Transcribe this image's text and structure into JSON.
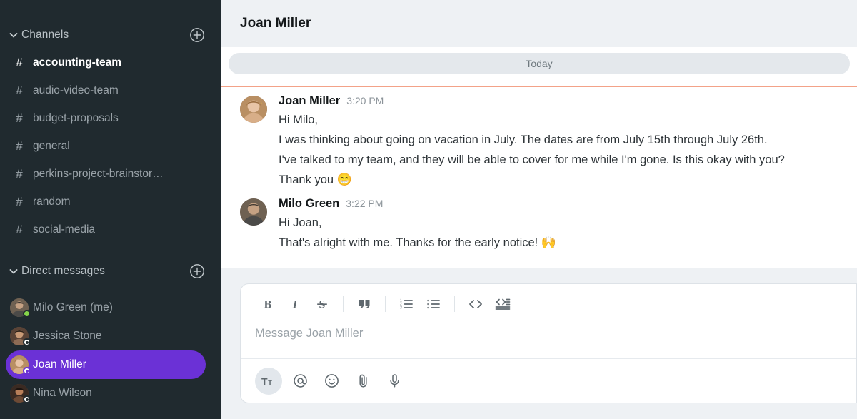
{
  "sidebar": {
    "channels_section": {
      "title": "Channels",
      "chevron_icon": "chevron-down-icon",
      "add_icon": "plus-circle-icon",
      "items": [
        {
          "label": "accounting-team",
          "prefix": "#",
          "active": true
        },
        {
          "label": "audio-video-team",
          "prefix": "#",
          "active": false
        },
        {
          "label": "budget-proposals",
          "prefix": "#",
          "active": false
        },
        {
          "label": "general",
          "prefix": "#",
          "active": false
        },
        {
          "label": "perkins-project-brainstor…",
          "prefix": "#",
          "active": false
        },
        {
          "label": "random",
          "prefix": "#",
          "active": false
        },
        {
          "label": "social-media",
          "prefix": "#",
          "active": false
        }
      ]
    },
    "dm_section": {
      "title": "Direct messages",
      "chevron_icon": "chevron-down-icon",
      "add_icon": "plus-circle-icon",
      "items": [
        {
          "label": "Milo Green (me)",
          "status": "online",
          "selected": false
        },
        {
          "label": "Jessica Stone",
          "status": "offline",
          "selected": false
        },
        {
          "label": "Joan Miller",
          "status": "offline",
          "selected": true
        },
        {
          "label": "Nina Wilson",
          "status": "offline",
          "selected": false
        }
      ]
    },
    "colors": {
      "background": "#202a2f",
      "selected_pill": "#6b31d6",
      "online": "#86d44a",
      "text_muted": "#9aa3a9"
    }
  },
  "header": {
    "title": "Joan Miller",
    "background": "#eef1f4"
  },
  "conversation": {
    "day_divider": "Today",
    "unread_line_color": "#f3a288",
    "messages": [
      {
        "author": "Joan Miller",
        "time": "3:20 PM",
        "avatar": "joan-avatar",
        "lines": [
          "Hi Milo,",
          "I was thinking about going on vacation in July. The dates are from July 15th through July 26th.",
          "I've talked to my team, and they will be able to cover for me while I'm gone. Is this okay with you?",
          "Thank you "
        ],
        "trailing_emoji": "😁"
      },
      {
        "author": "Milo Green",
        "time": "3:22 PM",
        "avatar": "milo-avatar",
        "lines": [
          "Hi Joan,",
          "That's alright with me. Thanks for the early notice! "
        ],
        "trailing_emoji": "🙌"
      }
    ]
  },
  "composer": {
    "placeholder": "Message Joan Miller",
    "format_buttons": [
      {
        "name": "bold-icon",
        "label": "B"
      },
      {
        "name": "italic-icon",
        "label": "I"
      },
      {
        "name": "strikethrough-icon",
        "label": "S"
      },
      {
        "name": "separator",
        "label": ""
      },
      {
        "name": "quote-icon",
        "label": "””"
      },
      {
        "name": "separator",
        "label": ""
      },
      {
        "name": "ordered-list-icon",
        "label": ""
      },
      {
        "name": "bulleted-list-icon",
        "label": ""
      },
      {
        "name": "separator",
        "label": ""
      },
      {
        "name": "code-icon",
        "label": "<>"
      },
      {
        "name": "code-block-icon",
        "label": ""
      }
    ],
    "action_buttons": [
      {
        "name": "text-format-icon",
        "label": "Tt",
        "active": true
      },
      {
        "name": "mention-icon",
        "label": "@",
        "active": false
      },
      {
        "name": "emoji-icon",
        "label": "",
        "active": false
      },
      {
        "name": "attachment-icon",
        "label": "",
        "active": false
      },
      {
        "name": "microphone-icon",
        "label": "",
        "active": false
      }
    ]
  }
}
